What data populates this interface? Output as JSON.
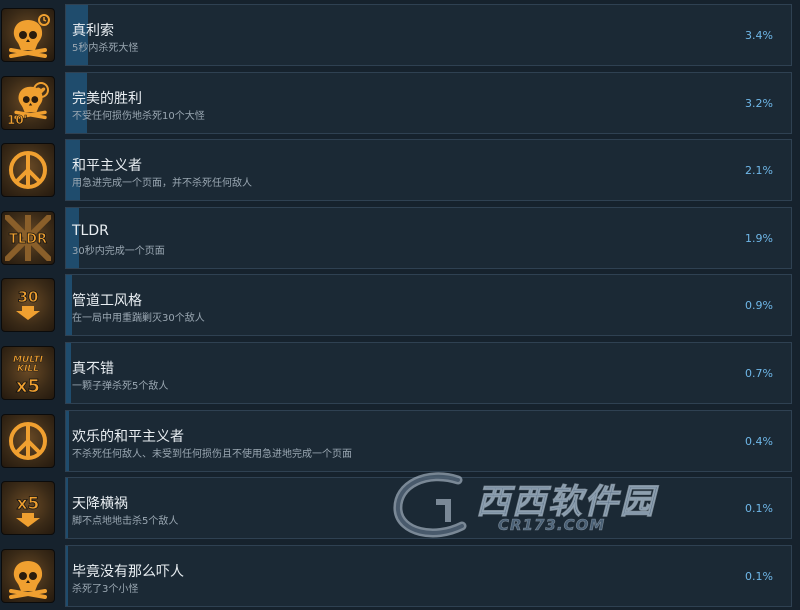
{
  "achievements": [
    {
      "title": "真利索",
      "description": "5秒内杀死大怪",
      "percent_label": "3.4%",
      "percent": 3.4,
      "icon": "skull-timer-icon"
    },
    {
      "title": "完美的胜利",
      "description": "不受任何损伤地杀死10个大怪",
      "percent_label": "3.2%",
      "percent": 3.2,
      "icon": "skull-heart-10-icon"
    },
    {
      "title": "和平主义者",
      "description": "用急进完成一个页面，并不杀死任何敌人",
      "percent_label": "2.1%",
      "percent": 2.1,
      "icon": "peace-sign-icon"
    },
    {
      "title": "TLDR",
      "description": "30秒内完成一个页面",
      "percent_label": "1.9%",
      "percent": 1.9,
      "icon": "tldr-icon"
    },
    {
      "title": "管道工风格",
      "description": "在一局中用重踹剿灭30个敌人",
      "percent_label": "0.9%",
      "percent": 0.9,
      "icon": "arrow-down-30-icon"
    },
    {
      "title": "真不错",
      "description": "一颗子弹杀死5个敌人",
      "percent_label": "0.7%",
      "percent": 0.7,
      "icon": "multi-kill-x5-icon"
    },
    {
      "title": "欢乐的和平主义者",
      "description": "不杀死任何敌人、未受到任何损伤且不使用急进地完成一个页面",
      "percent_label": "0.4%",
      "percent": 0.4,
      "icon": "peace-sign-icon"
    },
    {
      "title": "天降横祸",
      "description": "脚不点地地击杀5个敌人",
      "percent_label": "0.1%",
      "percent": 0.1,
      "icon": "arrow-down-x5-icon"
    },
    {
      "title": "毕竟没有那么吓人",
      "description": "杀死了3个小怪",
      "percent_label": "0.1%",
      "percent": 0.1,
      "icon": "skull-icon"
    }
  ],
  "icon_text": {
    "ten": "10",
    "tldr": "TLDR",
    "thirty": "30",
    "multi": "MULTI",
    "kill": "KILL",
    "x5": "x5"
  },
  "watermark": {
    "main": "西西软件园",
    "sub": "CR173.COM"
  },
  "colors": {
    "background": "#16222d",
    "row_bg": "#1b2935",
    "row_border": "#2f4152",
    "bar_fill": "#1f4c6d",
    "percent_text": "#6fb7e8",
    "icon_orange": "#f0a030"
  }
}
